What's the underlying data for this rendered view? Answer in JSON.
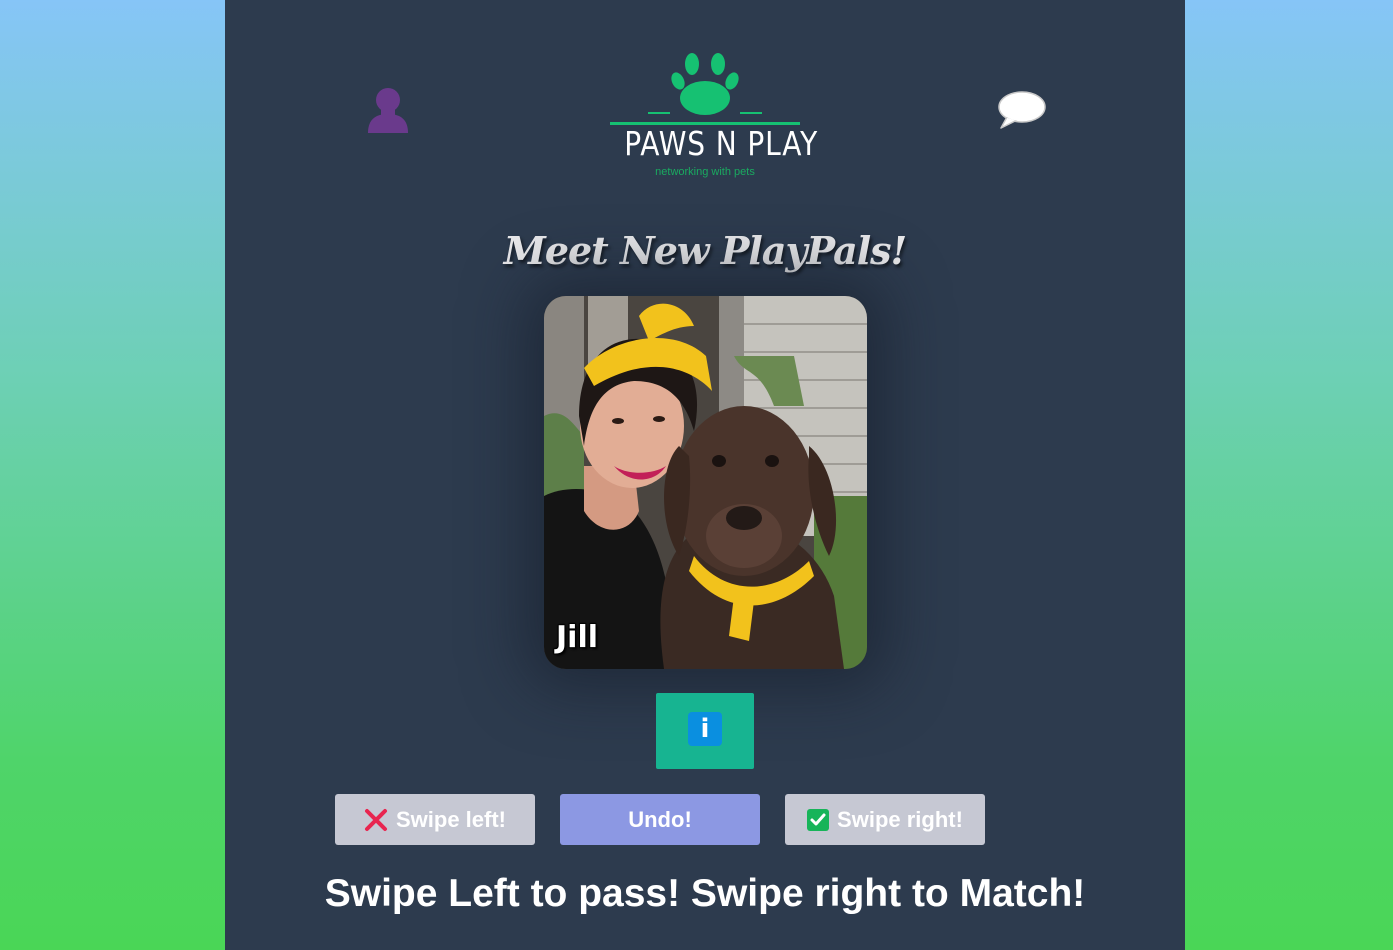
{
  "header": {
    "logo_title": "PAWS N PLAY",
    "logo_tagline": "networking with pets",
    "profile_icon": "user-icon",
    "chat_icon": "speech-bubble-icon"
  },
  "main": {
    "heading": "Meet New PlayPals!",
    "card": {
      "name": "Jill",
      "photo": "woman-with-chocolate-labrador"
    },
    "info_label": "i"
  },
  "actions": {
    "swipe_left_label": "Swipe left!",
    "undo_label": "Undo!",
    "swipe_right_label": "Swipe right!"
  },
  "footer": {
    "instructions": "Swipe Left to pass! Swipe right to Match!"
  },
  "colors": {
    "panel": "#2d3b4e",
    "brand_green": "#16c172",
    "info_button": "#17b491",
    "undo_button": "#8c98e3",
    "swipe_button": "#c6c8d3",
    "profile_icon": "#6a3a8c"
  }
}
